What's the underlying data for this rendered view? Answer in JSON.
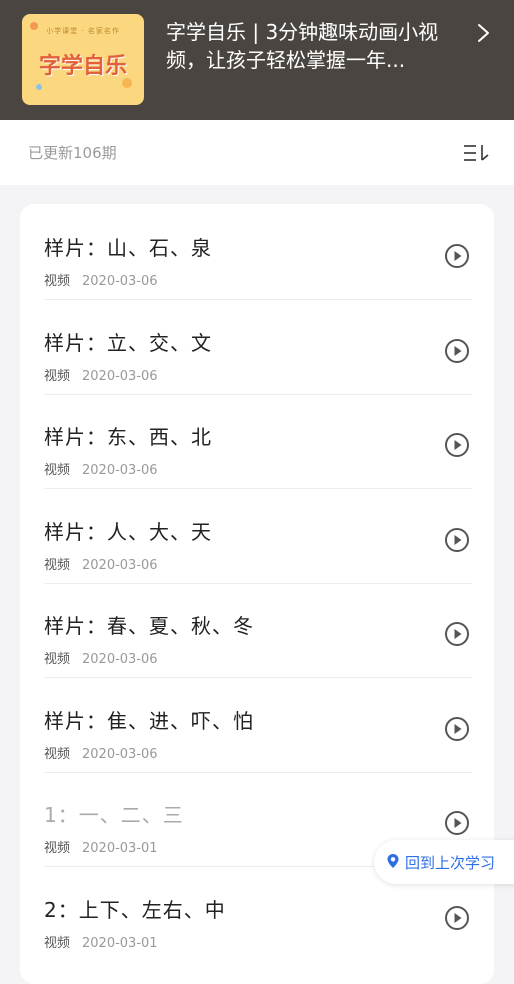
{
  "header": {
    "cover_small_text": "小学课堂 · 名家名作",
    "cover_logo_text": "字学自乐",
    "title": "字学自乐 | 3分钟趣味动画小视频，让孩子轻松掌握一年...",
    "chevron_icon": "chevron-right-icon"
  },
  "toolbar": {
    "count_text": "已更新106期",
    "sort_icon": "sort-icon"
  },
  "episodes": [
    {
      "title": "样片：山、石、泉",
      "tag": "视频",
      "date": "2020-03-06",
      "dimmed": false
    },
    {
      "title": "样片：立、交、文",
      "tag": "视频",
      "date": "2020-03-06",
      "dimmed": false
    },
    {
      "title": "样片：东、西、北",
      "tag": "视频",
      "date": "2020-03-06",
      "dimmed": false
    },
    {
      "title": "样片：人、大、天",
      "tag": "视频",
      "date": "2020-03-06",
      "dimmed": false
    },
    {
      "title": "样片：春、夏、秋、冬",
      "tag": "视频",
      "date": "2020-03-06",
      "dimmed": false
    },
    {
      "title": "样片：隹、进、吓、怕",
      "tag": "视频",
      "date": "2020-03-06",
      "dimmed": false
    },
    {
      "title": "1：一、二、三",
      "tag": "视频",
      "date": "2020-03-01",
      "dimmed": true
    },
    {
      "title": "2：上下、左右、中",
      "tag": "视频",
      "date": "2020-03-01",
      "dimmed": false
    }
  ],
  "resume_button": {
    "label": "回到上次学习",
    "icon": "location-pin-icon",
    "color": "#2f6fe6"
  },
  "colors": {
    "header_bg": "#4a4540",
    "cover_bg": "#fbd77f"
  }
}
